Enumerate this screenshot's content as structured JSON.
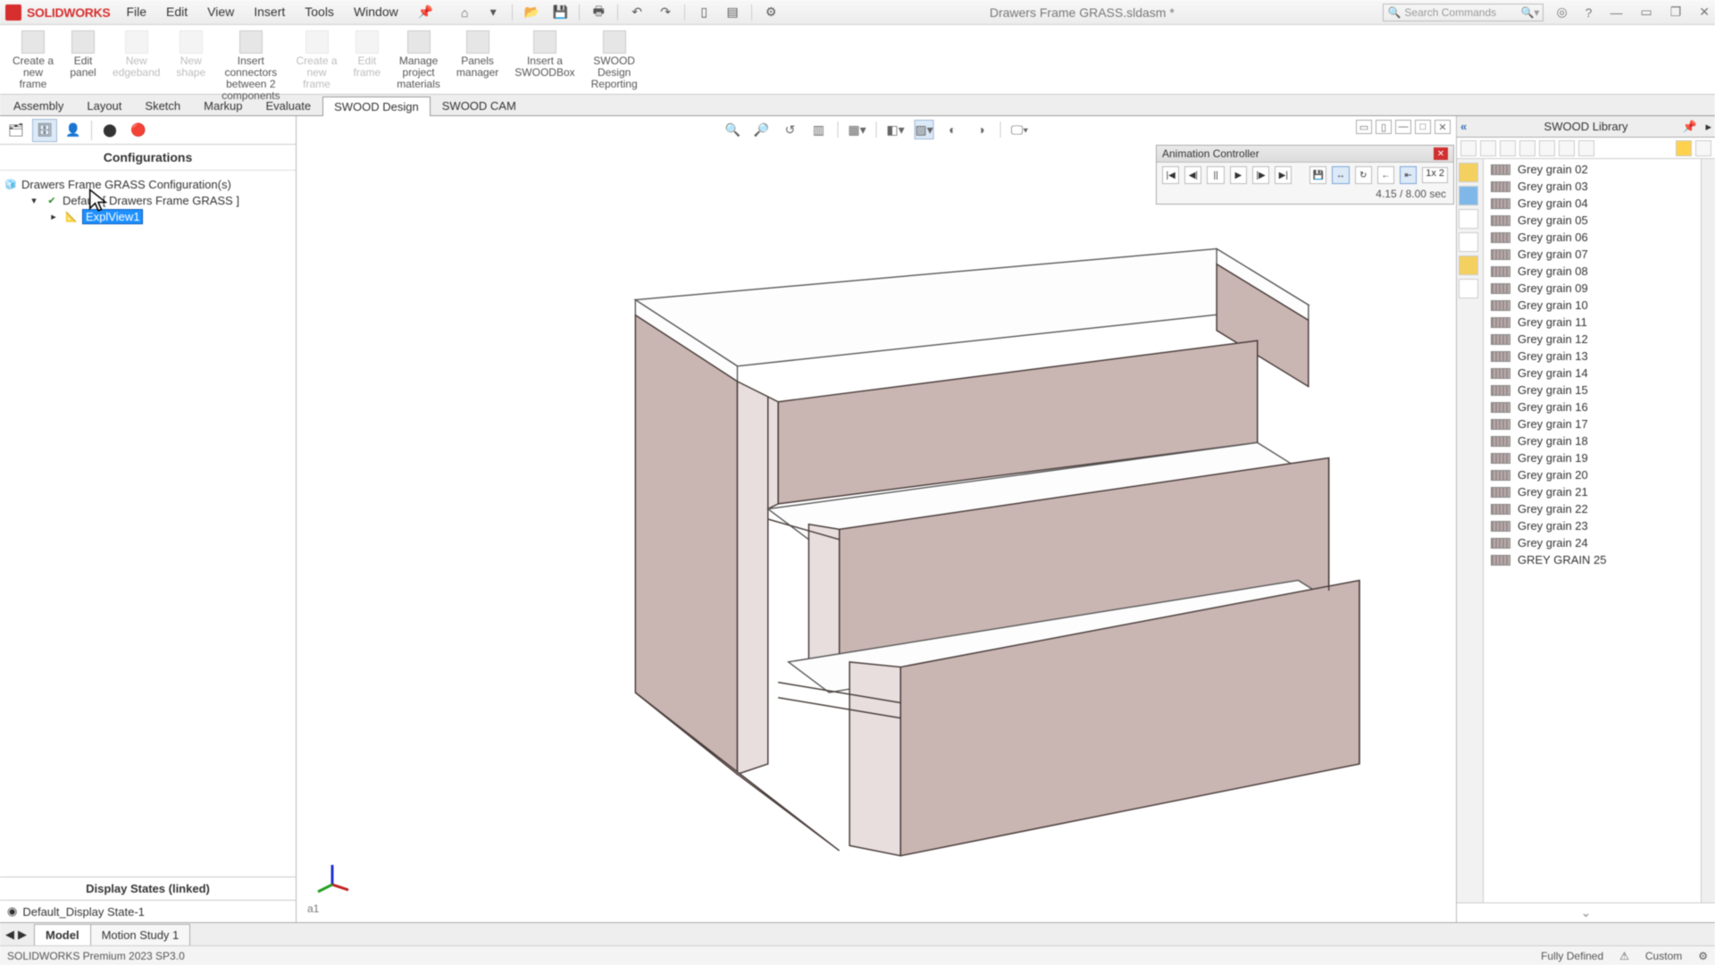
{
  "app": {
    "name": "SOLIDWORKS",
    "doc_title": "Drawers Frame GRASS.sldasm *"
  },
  "menu": [
    "File",
    "Edit",
    "View",
    "Insert",
    "Tools",
    "Window"
  ],
  "search": {
    "placeholder": "Search Commands"
  },
  "ribbon": [
    {
      "label": "Create a\nnew\nframe",
      "disabled": false
    },
    {
      "label": "Edit\npanel",
      "disabled": false
    },
    {
      "label": "New\nedgeband",
      "disabled": true
    },
    {
      "label": "New\nshape",
      "disabled": true
    },
    {
      "label": "Insert\nconnectors\nbetween 2\ncomponents",
      "disabled": false
    },
    {
      "label": "Create a\nnew\nframe",
      "disabled": true
    },
    {
      "label": "Edit\nframe",
      "disabled": true
    },
    {
      "label": "Manage\nproject\nmaterials",
      "disabled": false
    },
    {
      "label": "Panels\nmanager",
      "disabled": false
    },
    {
      "label": "Insert a\nSWOODBox",
      "disabled": false
    },
    {
      "label": "SWOOD\nDesign\nReporting",
      "disabled": false
    }
  ],
  "tabs": [
    "Assembly",
    "Layout",
    "Sketch",
    "Markup",
    "Evaluate",
    "SWOOD Design",
    "SWOOD CAM"
  ],
  "active_tab": "SWOOD Design",
  "left_panel": {
    "title": "Configurations",
    "root": "Drawers Frame GRASS Configuration(s)",
    "config": "Default [ Drawers Frame GRASS ]",
    "expl": "ExplView1",
    "display_states_title": "Display States (linked)",
    "display_state": "Default_Display State-1"
  },
  "hud_icons": [
    "zoom",
    "hand",
    "rotate",
    "section",
    "view",
    "cube",
    "shaded",
    "shadow",
    "scene",
    "camera",
    "render"
  ],
  "animation": {
    "title": "Animation Controller",
    "time": "4.15 / 8.00 sec",
    "speed": "1x 2"
  },
  "library": {
    "title": "SWOOD Library",
    "items": [
      "Grey grain 02",
      "Grey grain 03",
      "Grey grain 04",
      "Grey grain 05",
      "Grey grain 06",
      "Grey grain 07",
      "Grey grain 08",
      "Grey grain 09",
      "Grey grain 10",
      "Grey grain 11",
      "Grey grain 12",
      "Grey grain 13",
      "Grey grain 14",
      "Grey grain 15",
      "Grey grain 16",
      "Grey grain 17",
      "Grey grain 18",
      "Grey grain 19",
      "Grey grain 20",
      "Grey grain 21",
      "Grey grain 22",
      "Grey grain 23",
      "Grey grain 24",
      "GREY GRAIN 25"
    ]
  },
  "bottom": {
    "tabs": [
      "Model",
      "Motion Study 1"
    ],
    "active": "Model"
  },
  "status": {
    "left": "SOLIDWORKS Premium 2023 SP3.0",
    "right": [
      "Fully Defined",
      "Custom"
    ]
  },
  "viewport_label": "a1"
}
